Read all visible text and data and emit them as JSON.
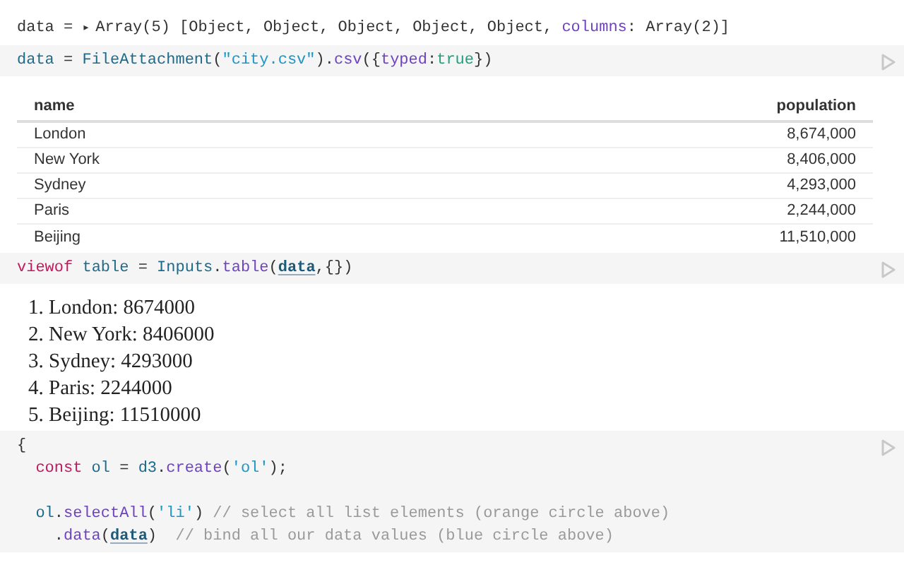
{
  "output_line": {
    "kind": "top",
    "tokens": [
      {
        "kind": "plain",
        "text": "data = "
      },
      {
        "kind": "toggle",
        "text": "▸"
      },
      {
        "kind": "plain",
        "text": "Array(5) [Object, Object, Object, Object, Object, "
      },
      {
        "kind": "property",
        "text": "columns"
      },
      {
        "kind": "plain",
        "text": ": Array(2)]"
      }
    ]
  },
  "cells": [
    {
      "kind": "code",
      "lines": [
        {
          "kind": "top",
          "tokens": [
            {
              "kind": "variable",
              "text": "data"
            },
            {
              "kind": "plain",
              "text": " = "
            },
            {
              "kind": "variable",
              "text": "FileAttachment"
            },
            {
              "kind": "plain",
              "text": "("
            },
            {
              "kind": "string",
              "text": "\"city.csv\""
            },
            {
              "kind": "plain",
              "text": ")."
            },
            {
              "kind": "method",
              "text": "csv"
            },
            {
              "kind": "plain",
              "text": "({"
            },
            {
              "kind": "property",
              "text": "typed"
            },
            {
              "kind": "plain",
              "text": ":"
            },
            {
              "kind": "literal",
              "text": "true"
            },
            {
              "kind": "plain",
              "text": "})"
            }
          ]
        }
      ]
    },
    {
      "kind": "table",
      "columns": [
        "name",
        "population"
      ],
      "rows": [
        [
          "London",
          "8,674,000"
        ],
        [
          "New York",
          "8,406,000"
        ],
        [
          "Sydney",
          "4,293,000"
        ],
        [
          "Paris",
          "2,244,000"
        ],
        [
          "Beijing",
          "11,510,000"
        ]
      ]
    },
    {
      "kind": "code",
      "lines": [
        {
          "kind": "top",
          "tokens": [
            {
              "kind": "keyword",
              "text": "viewof "
            },
            {
              "kind": "variable",
              "text": "table"
            },
            {
              "kind": "plain",
              "text": " = "
            },
            {
              "kind": "variable",
              "text": "Inputs"
            },
            {
              "kind": "plain",
              "text": "."
            },
            {
              "kind": "method",
              "text": "table"
            },
            {
              "kind": "plain",
              "text": "("
            },
            {
              "kind": "reference",
              "text": "data"
            },
            {
              "kind": "plain",
              "text": ",{})"
            }
          ]
        }
      ]
    },
    {
      "kind": "list",
      "items": [
        "1. London: 8674000",
        "2. New York: 8406000",
        "3. Sydney: 4293000",
        "4. Paris: 2244000",
        "5. Beijing: 11510000"
      ]
    },
    {
      "kind": "code",
      "lines": [
        {
          "kind": "top",
          "tokens": [
            {
              "kind": "plain",
              "text": "{"
            }
          ]
        },
        {
          "kind": "inner",
          "tokens": [
            {
              "kind": "keyword",
              "text": "const "
            },
            {
              "kind": "variable",
              "text": "ol"
            },
            {
              "kind": "plain",
              "text": " = "
            },
            {
              "kind": "variable",
              "text": "d3"
            },
            {
              "kind": "plain",
              "text": "."
            },
            {
              "kind": "method",
              "text": "create"
            },
            {
              "kind": "plain",
              "text": "("
            },
            {
              "kind": "string",
              "text": "'ol'"
            },
            {
              "kind": "plain",
              "text": ");"
            }
          ]
        },
        {
          "kind": "blank"
        },
        {
          "kind": "inner",
          "tokens": [
            {
              "kind": "variable",
              "text": "ol"
            },
            {
              "kind": "plain",
              "text": "."
            },
            {
              "kind": "method",
              "text": "selectAll"
            },
            {
              "kind": "plain",
              "text": "("
            },
            {
              "kind": "string",
              "text": "'li'"
            },
            {
              "kind": "plain",
              "text": ") "
            },
            {
              "kind": "comment",
              "text": "// select all list elements (orange circle above)"
            }
          ]
        },
        {
          "kind": "chain",
          "tokens": [
            {
              "kind": "plain",
              "text": "."
            },
            {
              "kind": "method",
              "text": "data"
            },
            {
              "kind": "plain",
              "text": "("
            },
            {
              "kind": "reference",
              "text": "data"
            },
            {
              "kind": "plain",
              "text": ")  "
            },
            {
              "kind": "comment",
              "text": "// bind all our data values (blue circle above)"
            }
          ]
        }
      ]
    }
  ]
}
